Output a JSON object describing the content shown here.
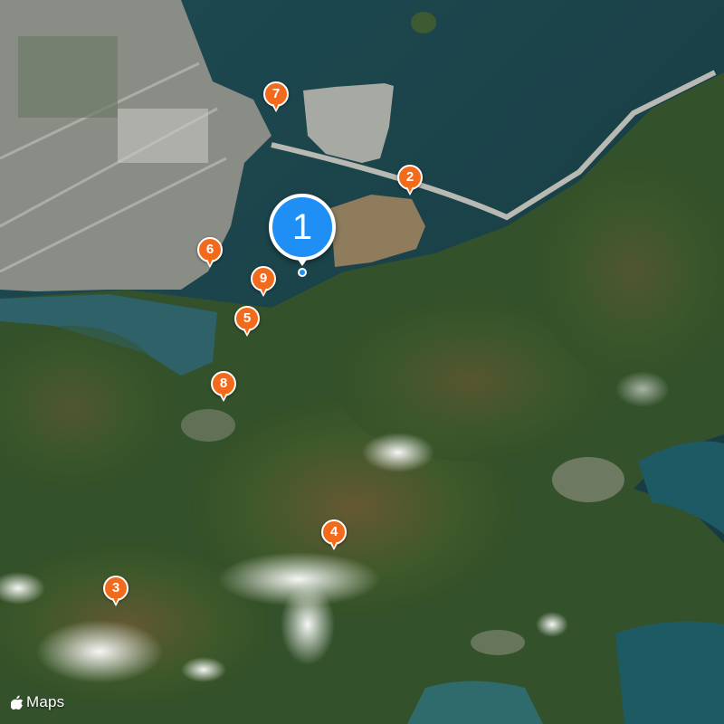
{
  "map": {
    "view": "satellite",
    "brand": {
      "icon": "apple-logo-icon",
      "label": "Maps"
    },
    "primary_marker": {
      "label": "1",
      "color": "#1f8ff5"
    },
    "markers": [
      {
        "id": "2",
        "label": "2",
        "color": "#f26a1b"
      },
      {
        "id": "3",
        "label": "3",
        "color": "#f26a1b"
      },
      {
        "id": "4",
        "label": "4",
        "color": "#f26a1b"
      },
      {
        "id": "5",
        "label": "5",
        "color": "#f26a1b"
      },
      {
        "id": "6",
        "label": "6",
        "color": "#f26a1b"
      },
      {
        "id": "7",
        "label": "7",
        "color": "#f26a1b"
      },
      {
        "id": "8",
        "label": "8",
        "color": "#f26a1b"
      },
      {
        "id": "9",
        "label": "9",
        "color": "#f26a1b"
      }
    ]
  }
}
